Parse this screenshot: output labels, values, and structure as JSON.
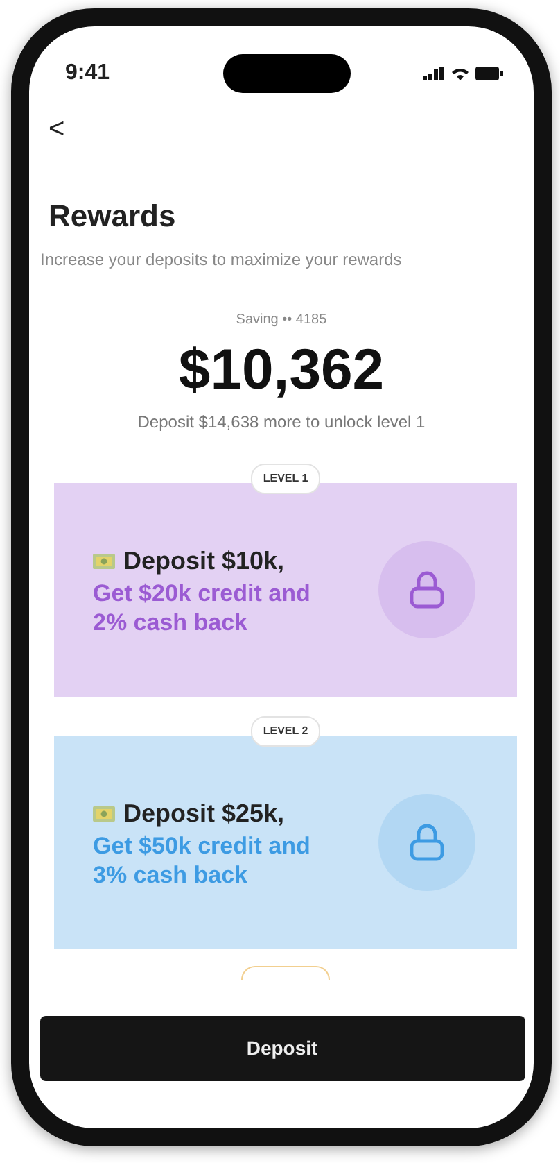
{
  "status_bar": {
    "time": "9:41"
  },
  "header": {
    "back": "<",
    "title": "Rewards",
    "subtitle": "Increase your deposits to maximize your rewards"
  },
  "balance": {
    "account": "Saving •• 4185",
    "amount": "$10,362",
    "note": "Deposit $14,638 more to unlock level 1"
  },
  "levels": [
    {
      "kind": "card",
      "tag": "LEVEL 1",
      "headline": "Deposit $10k,",
      "benefit": "Get $20k credit and 2% cash back",
      "color": "#9b5bd3",
      "locked": true
    },
    {
      "kind": "card",
      "tag": "LEVEL 2",
      "headline": "Deposit $25k,",
      "benefit": "Get $50k credit and 3% cash back",
      "color": "#3d9be3",
      "locked": true
    },
    {
      "kind": "peek",
      "color": "#f2cf8f"
    }
  ],
  "action": {
    "label": "Deposit"
  }
}
